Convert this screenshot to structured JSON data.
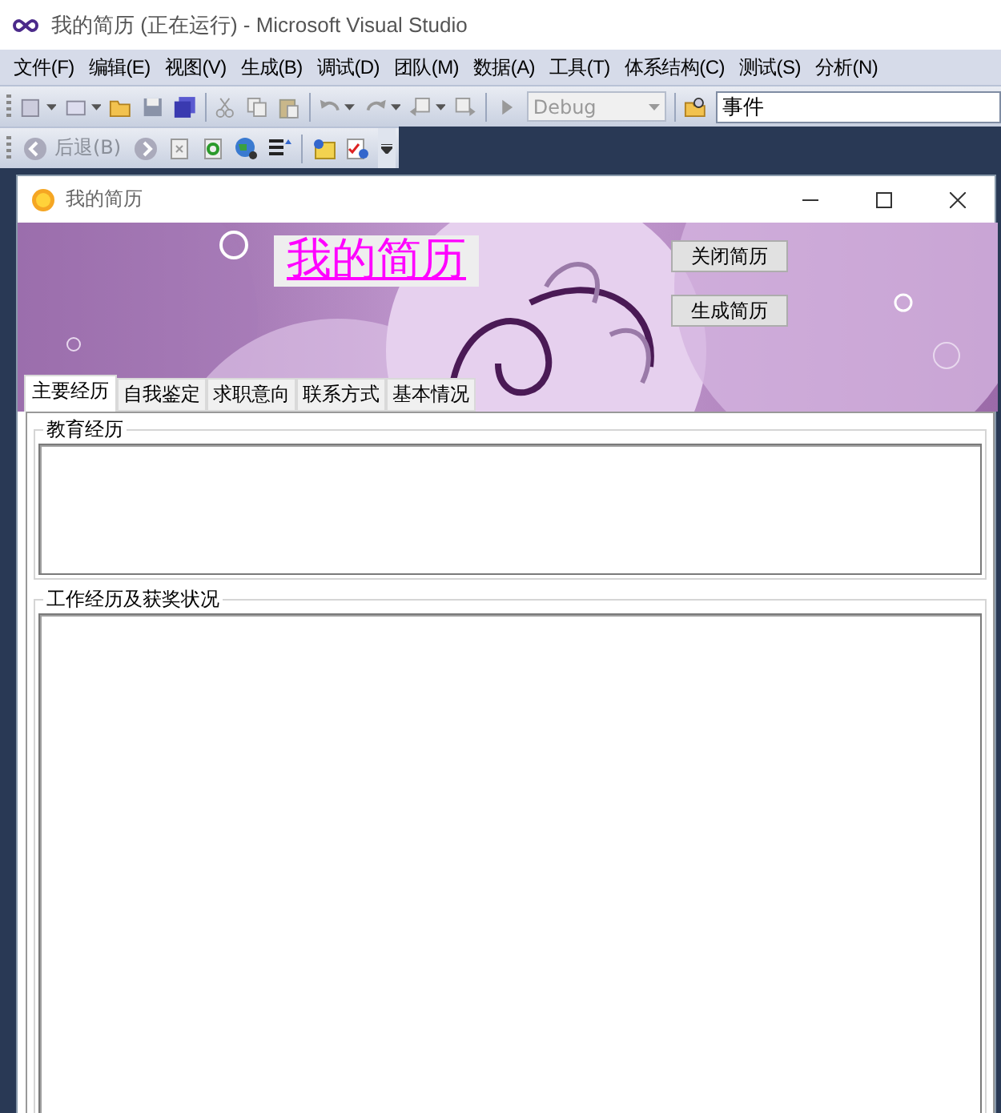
{
  "ide_window": {
    "title": "我的简历 (正在运行) - Microsoft Visual Studio"
  },
  "menu_bar": [
    "文件(F)",
    "编辑(E)",
    "视图(V)",
    "生成(B)",
    "调试(D)",
    "团队(M)",
    "数据(A)",
    "工具(T)",
    "体系结构(C)",
    "测试(S)",
    "分析(N)"
  ],
  "toolbar": {
    "configuration": {
      "value": "Debug",
      "disabled": true
    },
    "find_field": {
      "value": "事件"
    }
  },
  "web_toolbar": {
    "back_button": {
      "label": "后退(B)",
      "disabled": true
    }
  },
  "app_window": {
    "title": "我的简历",
    "header": {
      "title": "我的简历",
      "buttons": [
        "关闭简历",
        "生成简历"
      ]
    },
    "tabs": [
      {
        "label": "主要经历",
        "selected": true
      },
      {
        "label": "自我鉴定",
        "selected": false
      },
      {
        "label": "求职意向",
        "selected": false
      },
      {
        "label": "联系方式",
        "selected": false
      },
      {
        "label": "基本情况",
        "selected": false
      }
    ],
    "groups": [
      {
        "title": "教育经历"
      },
      {
        "title": "工作经历及获奖状况"
      }
    ]
  }
}
